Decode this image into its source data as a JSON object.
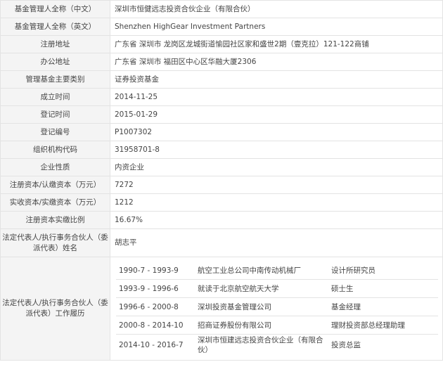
{
  "rows": [
    {
      "label": "基金管理人全称（中文）",
      "value": "深圳市恒健远志投资合伙企业（有限合伙）"
    },
    {
      "label": "基金管理人全称（英文）",
      "value": "Shenzhen HighGear Investment Partners"
    },
    {
      "label": "注册地址",
      "value": "广东省 深圳市 龙岗区龙城街道愉园社区家和盛世2期（壹克拉）121-122商铺"
    },
    {
      "label": "办公地址",
      "value": "广东省 深圳市 福田区中心区华融大厦2306"
    },
    {
      "label": "管理基金主要类别",
      "value": "证券投资基金"
    },
    {
      "label": "成立时间",
      "value": "2014-11-25"
    },
    {
      "label": "登记时间",
      "value": "2015-01-29"
    },
    {
      "label": "登记编号",
      "value": "P1007302"
    },
    {
      "label": "组织机构代码",
      "value": "31958701-8"
    },
    {
      "label": "企业性质",
      "value": "内资企业"
    },
    {
      "label": "注册资本/认缴资本（万元）",
      "value": "7272"
    },
    {
      "label": "实收资本/实缴资本（万元）",
      "value": "1212"
    },
    {
      "label": "注册资本实缴比例",
      "value": "16.67%"
    }
  ],
  "representative": {
    "label": "法定代表人/执行事务合伙人（委派代表）姓名",
    "value": "胡志平"
  },
  "work_history": {
    "label": "法定代表人/执行事务合伙人（委派代表）工作履历",
    "entries": [
      {
        "period": "1990-7 - 1993-9",
        "org": "航空工业总公司中南传动机械厂",
        "title": "设计所研究员"
      },
      {
        "period": "1993-9 - 1996-6",
        "org": "就读于北京航空航天大学",
        "title": "硕士生"
      },
      {
        "period": "1996-6 - 2000-8",
        "org": "深圳投资基金管理公司",
        "title": "基金经理"
      },
      {
        "period": "2000-8 - 2014-10",
        "org": "招商证券股份有限公司",
        "title": "理财投资部总经理助理"
      },
      {
        "period": "2014-10 - 2016-7",
        "org": "深圳市恒建远志投资合伙企业（有限合伙）",
        "title": "投资总监"
      }
    ]
  },
  "colors": {
    "label_bg": "#f4f4f4",
    "border": "#e3e3e3",
    "text": "#444444"
  }
}
